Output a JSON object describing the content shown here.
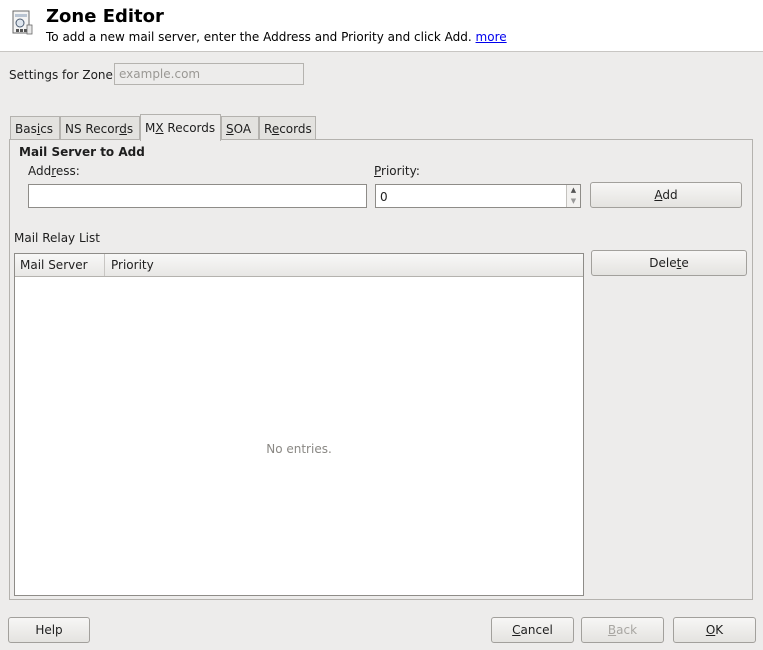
{
  "header": {
    "title": "Zone Editor",
    "description": "To add a new mail server, enter the Address and Priority and click Add.",
    "more_link": "more",
    "icon": "zone-editor-icon"
  },
  "zone": {
    "label": "Settings for Zone",
    "value": "example.com"
  },
  "tabs": [
    {
      "pre": "Bas",
      "u": "i",
      "post": "cs"
    },
    {
      "pre": "NS Recor",
      "u": "d",
      "post": "s"
    },
    {
      "pre": "M",
      "u": "X",
      "post": " Records"
    },
    {
      "pre": "",
      "u": "S",
      "post": "OA"
    },
    {
      "pre": "R",
      "u": "e",
      "post": "cords"
    }
  ],
  "active_tab": "MX Records",
  "mail_server": {
    "section_title": "Mail Server to Add",
    "address_label_pre": "Add",
    "address_label_u": "r",
    "address_label_post": "ess:",
    "address_value": "",
    "priority_label_pre": "",
    "priority_label_u": "P",
    "priority_label_post": "riority:",
    "priority_value": "0",
    "add_pre": "",
    "add_u": "A",
    "add_post": "dd"
  },
  "relay": {
    "label": "Mail Relay List",
    "columns": [
      "Mail Server",
      "Priority"
    ],
    "empty_text": "No entries.",
    "delete_pre": "Dele",
    "delete_u": "t",
    "delete_post": "e"
  },
  "footer": {
    "help": "Help",
    "cancel_pre": "",
    "cancel_u": "C",
    "cancel_post": "ancel",
    "back_pre": "",
    "back_u": "B",
    "back_post": "ack",
    "ok_pre": "",
    "ok_u": "O",
    "ok_post": "K"
  }
}
